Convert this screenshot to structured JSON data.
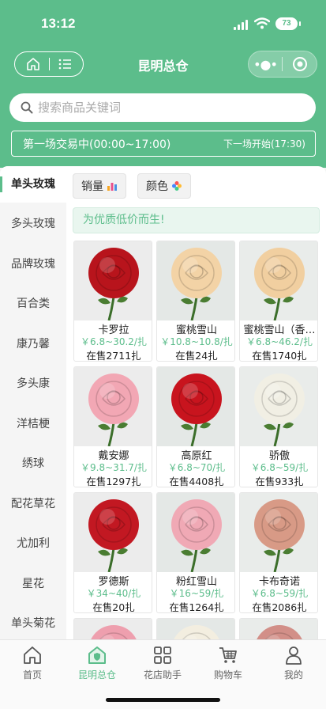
{
  "status": {
    "time": "13:12",
    "battery": "73"
  },
  "navbar": {
    "title": "昆明总仓"
  },
  "search": {
    "placeholder": "搜索商品关键词"
  },
  "trade": {
    "current": "第一场交易中(00:00~17:00)",
    "next": "下一场开始(17:30)"
  },
  "categories": [
    "单头玫瑰",
    "多头玫瑰",
    "品牌玫瑰",
    "百合类",
    "康乃馨",
    "多头康",
    "洋桔梗",
    "绣球",
    "配花草花",
    "尤加利",
    "星花",
    "单头菊花"
  ],
  "sort": {
    "sales": "销量",
    "color": "颜色"
  },
  "banner": "为优质低价而生!",
  "products": [
    {
      "name": "卡罗拉",
      "price": "￥6.8~30.2/扎",
      "stock": "在售2711扎",
      "color": "#b8141c"
    },
    {
      "name": "蜜桃雪山",
      "price": "￥10.8~10.8/扎",
      "stock": "在售24扎",
      "color": "#f3d3a6"
    },
    {
      "name": "蜜桃雪山（香…",
      "price": "￥6.8~46.2/扎",
      "stock": "在售1740扎",
      "color": "#f1cfa0"
    },
    {
      "name": "戴安娜",
      "price": "￥9.8~31.7/扎",
      "stock": "在售1297扎",
      "color": "#f2a7b4"
    },
    {
      "name": "高原红",
      "price": "￥6.8~70/扎",
      "stock": "在售4408扎",
      "color": "#c8141e"
    },
    {
      "name": "骄傲",
      "price": "￥6.8~59/扎",
      "stock": "在售933扎",
      "color": "#f1efe4"
    },
    {
      "name": "罗德斯",
      "price": "￥34~40/扎",
      "stock": "在售20扎",
      "color": "#c21822"
    },
    {
      "name": "粉红雪山",
      "price": "￥16~59/扎",
      "stock": "在售1264扎",
      "color": "#f0a9b5"
    },
    {
      "name": "卡布奇诺",
      "price": "￥6.8~59/扎",
      "stock": "在售2086扎",
      "color": "#d89a86"
    },
    {
      "name": "",
      "price": "",
      "stock": "",
      "color": "#ee9fae"
    },
    {
      "name": "",
      "price": "",
      "stock": "",
      "color": "#f3eee0"
    },
    {
      "name": "",
      "price": "",
      "stock": "",
      "color": "#d28f88"
    }
  ],
  "tabs": [
    "首页",
    "昆明总仓",
    "花店助手",
    "购物车",
    "我的"
  ],
  "colors": {
    "primary": "#5cbd8b",
    "background": "#f3f5f4"
  }
}
